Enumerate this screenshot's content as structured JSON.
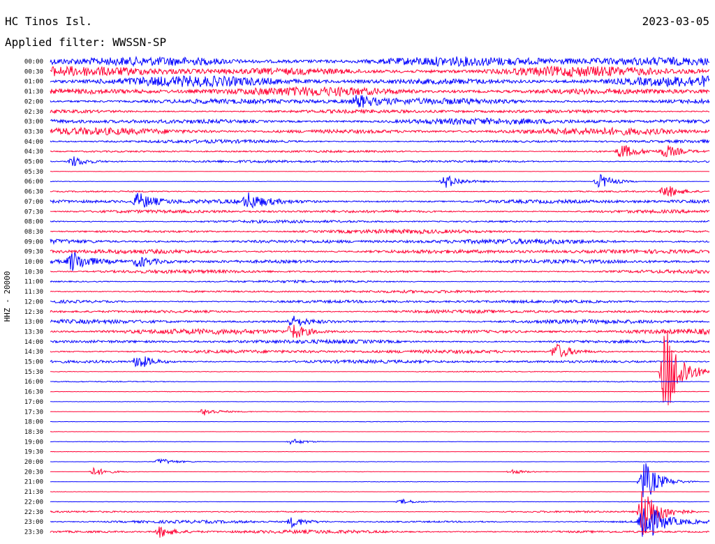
{
  "header": {
    "station": "HC Tinos Isl.",
    "date": "2023-03-05",
    "filter": "Applied filter: WWSSN-SP"
  },
  "channel_label": "HHZ - 20000",
  "colors": {
    "even_trace": "#0000ff",
    "odd_trace": "#ff0033",
    "text": "#000000",
    "background": "#ffffff"
  },
  "chart_data": {
    "type": "line",
    "description_kind": "helicorder",
    "row_labels": [
      "00:00",
      "00:30",
      "01:00",
      "01:30",
      "02:00",
      "02:30",
      "03:00",
      "03:30",
      "04:00",
      "04:30",
      "05:00",
      "05:30",
      "06:00",
      "06:30",
      "07:00",
      "07:30",
      "08:00",
      "08:30",
      "09:00",
      "09:30",
      "10:00",
      "10:30",
      "11:00",
      "11:30",
      "12:00",
      "12:30",
      "13:00",
      "13:30",
      "14:00",
      "14:30",
      "15:00",
      "15:30",
      "16:00",
      "16:30",
      "17:00",
      "17:30",
      "18:00",
      "18:30",
      "19:00",
      "19:30",
      "20:00",
      "20:30",
      "21:00",
      "21:30",
      "22:00",
      "22:30",
      "23:00",
      "23:30"
    ],
    "row_noise_level": [
      0.95,
      0.9,
      0.9,
      0.8,
      0.6,
      0.35,
      0.55,
      0.6,
      0.3,
      0.2,
      0.25,
      0.05,
      0.08,
      0.12,
      0.4,
      0.3,
      0.25,
      0.35,
      0.45,
      0.4,
      0.35,
      0.3,
      0.2,
      0.25,
      0.3,
      0.3,
      0.35,
      0.45,
      0.35,
      0.35,
      0.3,
      0.08,
      0.08,
      0.06,
      0.05,
      0.06,
      0.05,
      0.04,
      0.05,
      0.04,
      0.05,
      0.05,
      0.04,
      0.04,
      0.05,
      0.15,
      0.25,
      0.3
    ],
    "events": [
      {
        "row": 20,
        "minute": 1,
        "amplitude": 1.6
      },
      {
        "row": 4,
        "minute": 14,
        "amplitude": 1.0
      },
      {
        "row": 9,
        "minute": 26,
        "amplitude": 1.2
      },
      {
        "row": 9,
        "minute": 28,
        "amplitude": 1.0
      },
      {
        "row": 10,
        "minute": 1,
        "amplitude": 0.9
      },
      {
        "row": 12,
        "minute": 18,
        "amplitude": 1.1
      },
      {
        "row": 12,
        "minute": 25,
        "amplitude": 1.2
      },
      {
        "row": 13,
        "minute": 28,
        "amplitude": 1.1
      },
      {
        "row": 14,
        "minute": 4,
        "amplitude": 1.4
      },
      {
        "row": 14,
        "minute": 9,
        "amplitude": 1.2
      },
      {
        "row": 20,
        "minute": 4,
        "amplitude": 0.9
      },
      {
        "row": 26,
        "minute": 11,
        "amplitude": 0.9
      },
      {
        "row": 27,
        "minute": 11,
        "amplitude": 1.3
      },
      {
        "row": 29,
        "minute": 23,
        "amplitude": 1.4
      },
      {
        "row": 30,
        "minute": 4,
        "amplitude": 1.2
      },
      {
        "row": 35,
        "minute": 7,
        "amplitude": 0.6
      },
      {
        "row": 38,
        "minute": 11,
        "amplitude": 0.5
      },
      {
        "row": 40,
        "minute": 5,
        "amplitude": 0.5
      },
      {
        "row": 41,
        "minute": 2,
        "amplitude": 0.7
      },
      {
        "row": 41,
        "minute": 21,
        "amplitude": 0.4
      },
      {
        "row": 44,
        "minute": 16,
        "amplitude": 0.4
      },
      {
        "row": 46,
        "minute": 11,
        "amplitude": 0.8
      },
      {
        "row": 47,
        "minute": 5,
        "amplitude": 0.9
      },
      {
        "row": 31,
        "minute": 28,
        "amplitude": 8
      },
      {
        "row": 42,
        "minute": 27,
        "amplitude": 3.5
      },
      {
        "row": 45,
        "minute": 27,
        "amplitude": 5
      },
      {
        "row": 46,
        "minute": 27,
        "amplitude": 4
      }
    ],
    "x_minutes_per_row": 30
  }
}
